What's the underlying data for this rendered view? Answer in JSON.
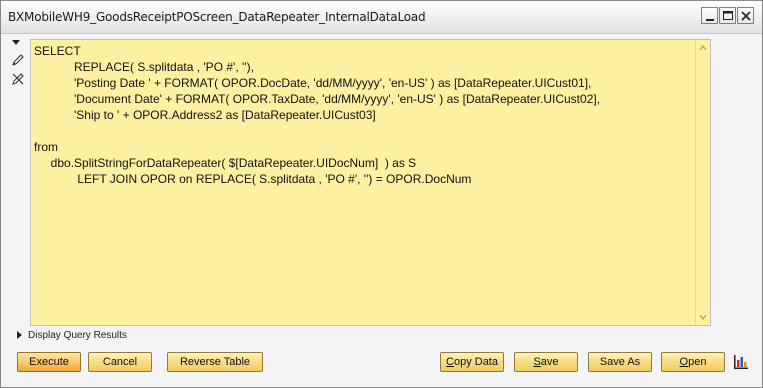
{
  "window": {
    "title": "BXMobileWH9_GoodsReceiptPOScreen_DataRepeater_InternalDataLoad"
  },
  "editor": {
    "query_text": "SELECT\n            REPLACE( S.splitdata , 'PO #', ''),\n            'Posting Date ' + FORMAT( OPOR.DocDate, 'dd/MM/yyyy', 'en-US' ) as [DataRepeater.UICust01],\n            'Document Date' + FORMAT( OPOR.TaxDate, 'dd/MM/yyyy', 'en-US' ) as [DataRepeater.UICust02],\n            'Ship to ' + OPOR.Address2 as [DataRepeater.UICust03]\n\nfrom\n     dbo.SplitStringForDataRepeater( $[DataRepeater.UIDocNum]  ) as S\n             LEFT JOIN OPOR on REPLACE( S.splitdata , 'PO #', '') = OPOR.DocNum"
  },
  "display_results": {
    "label": "Display Query Results"
  },
  "buttons": {
    "execute": "Execute",
    "cancel": "Cancel",
    "reverse_table": "Reverse Table",
    "copy_data_u": "C",
    "copy_data_rest": "opy Data",
    "save_u": "S",
    "save_rest": "ave",
    "save_as": "Save As",
    "open_u": "O",
    "open_rest": "pen"
  },
  "icons": {
    "collapse": "triangle-down-icon",
    "edit": "pencil-icon",
    "clear": "eraser-icon",
    "minimize": "minimize-icon",
    "maximize": "maximize-icon",
    "close": "close-icon",
    "chart": "bar-chart-icon"
  },
  "colors": {
    "editor_bg": "#fcf0a1",
    "button_bg": "#f7dc84",
    "primary_button_bg": "#f9c86b"
  }
}
